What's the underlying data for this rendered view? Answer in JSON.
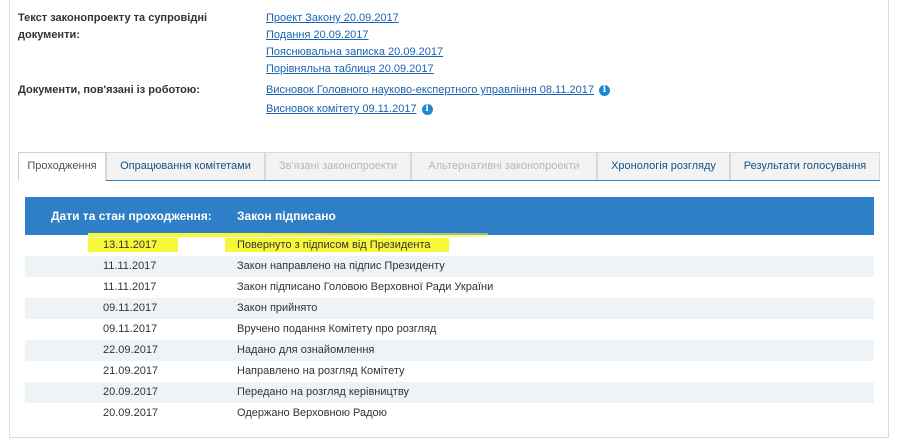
{
  "documents": {
    "text_label": "Текст законопроекту та супровідні документи:",
    "text_links": [
      "Проект Закону 20.09.2017",
      "Подання 20.09.2017",
      "Пояснювальна записка 20.09.2017",
      "Порівняльна таблиця 20.09.2017"
    ],
    "related_label": "Документи, пов'язані із роботою:",
    "related_links": [
      "Висновок Головного науково-експертного управління 08.11.2017",
      "Висновок комітету 09.11.2017"
    ],
    "info_glyph": "i"
  },
  "tabs": [
    {
      "label": "Проходження",
      "state": "active"
    },
    {
      "label": "Опрацювання комітетами",
      "state": "enabled"
    },
    {
      "label": "Зв'язані законопроекти",
      "state": "disabled"
    },
    {
      "label": "Альтернативні законопроекти",
      "state": "disabled"
    },
    {
      "label": "Хронологія розгляду",
      "state": "enabled"
    },
    {
      "label": "Результати голосування",
      "state": "enabled"
    }
  ],
  "passage": {
    "header_dates": "Дати та стан проходження:",
    "header_status": "Закон підписано",
    "rows": [
      {
        "date": "13.11.2017",
        "text": "Повернуто з підписом від Президента",
        "highlighted": true
      },
      {
        "date": "11.11.2017",
        "text": "Закон направлено на підпис Президенту"
      },
      {
        "date": "11.11.2017",
        "text": "Закон підписано Головою Верховної Ради України"
      },
      {
        "date": "09.11.2017",
        "text": "Закон прийнято"
      },
      {
        "date": "09.11.2017",
        "text": "Вручено подання Комітету про розгляд"
      },
      {
        "date": "22.09.2017",
        "text": "Надано для ознайомлення"
      },
      {
        "date": "21.09.2017",
        "text": "Направлено на розгляд Комітету"
      },
      {
        "date": "20.09.2017",
        "text": "Передано на розгляд керівництву"
      },
      {
        "date": "20.09.2017",
        "text": "Одержано Верховною Радою"
      }
    ]
  },
  "colors": {
    "accent": "#2f7fc8",
    "link": "#1a64b4",
    "highlight": "#f7f73a",
    "row_alt": "#eef3f8"
  }
}
